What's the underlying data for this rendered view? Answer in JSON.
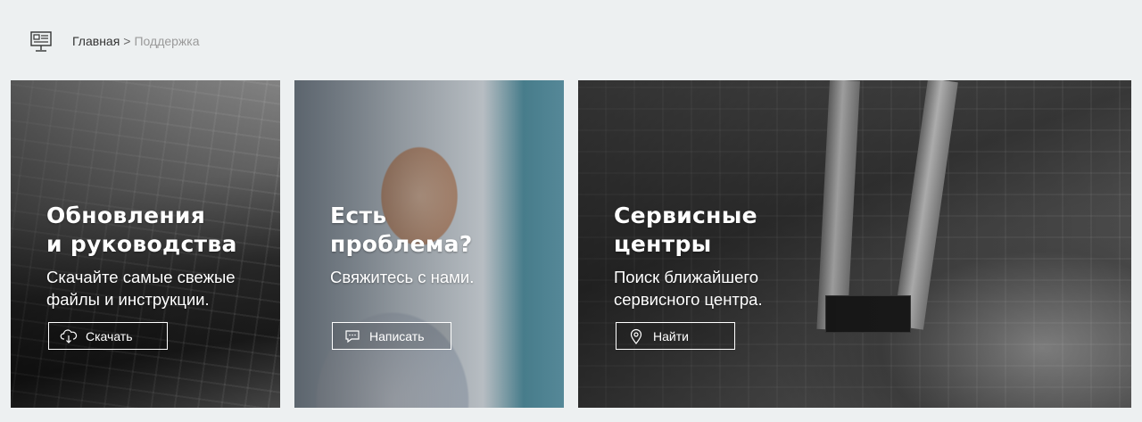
{
  "breadcrumb": {
    "home": "Главная",
    "separator": ">",
    "current": "Поддержка"
  },
  "cards": [
    {
      "title": "Обновления\nи руководства",
      "text": "Скачайте самые свежые\nфайлы и инструкции.",
      "button": "Скачать",
      "icon": "cloud-download-icon"
    },
    {
      "title": "Есть\nпроблема?",
      "text": "Свяжитесь с нами.",
      "button": "Написать",
      "icon": "chat-bubble-icon"
    },
    {
      "title": "Сервисные\nцентры",
      "text": "Поиск ближайшего\nсервисного центра.",
      "button": "Найти",
      "icon": "map-pin-icon"
    }
  ],
  "colors": {
    "page_background": "#edf0f1",
    "card_text": "#ffffff",
    "breadcrumb_current": "#9a9a9a"
  }
}
